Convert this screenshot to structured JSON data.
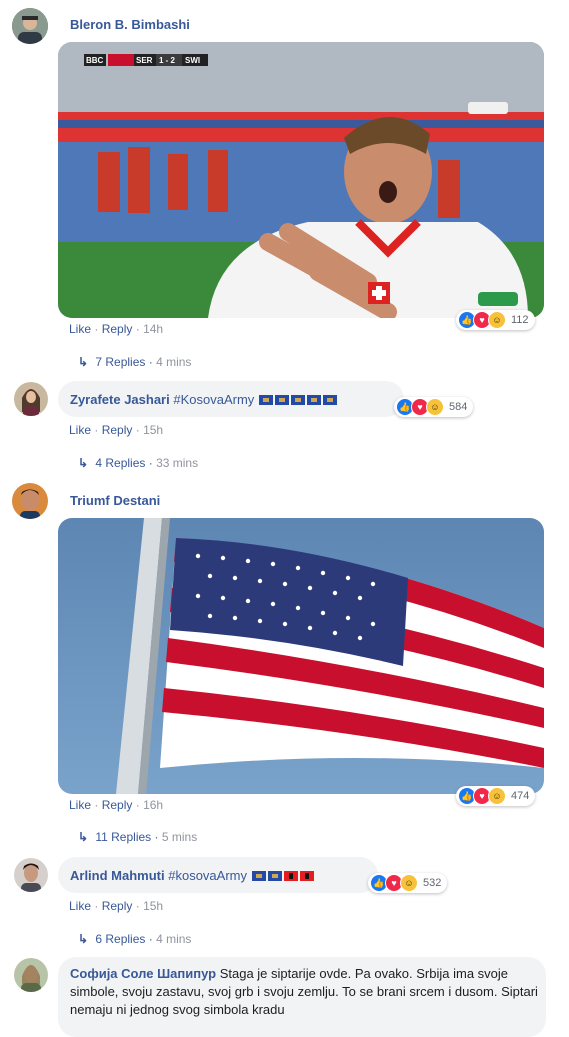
{
  "comments": [
    {
      "author": "Bleron B. Bimbashi",
      "actions": {
        "like": "Like",
        "reply": "Reply",
        "time": "14h"
      },
      "media": {
        "scoreboard": {
          "left_team": "SER",
          "score": "1 - 2",
          "right_team": "SWI",
          "broadcaster": "BBC"
        }
      },
      "reactions": {
        "count": "112"
      },
      "replies": {
        "label": "7 Replies",
        "ago": "4 mins"
      }
    },
    {
      "author": "Zyrafete Jashari",
      "text": "#KosovaArmy",
      "actions": {
        "like": "Like",
        "reply": "Reply",
        "time": "15h"
      },
      "reactions": {
        "count": "584"
      },
      "replies": {
        "label": "4 Replies",
        "ago": "33 mins"
      }
    },
    {
      "author": "Triumf Destani",
      "actions": {
        "like": "Like",
        "reply": "Reply",
        "time": "16h"
      },
      "reactions": {
        "count": "474"
      },
      "replies": {
        "label": "11 Replies",
        "ago": "5 mins"
      }
    },
    {
      "author": "Arlind Mahmuti",
      "text": "#kosovaArmy",
      "actions": {
        "like": "Like",
        "reply": "Reply",
        "time": "15h"
      },
      "reactions": {
        "count": "532"
      },
      "replies": {
        "label": "6 Replies",
        "ago": "4 mins"
      }
    },
    {
      "author": "Софија Соле Шапипур",
      "text": "Staga je siptarije ovde. Pa ovako. Srbija ima svoje simbole, svoju zastavu, svoj grb i svoju zemlju. To se brani srcem i dusom. Siptari nemaju ni jednog svog simbola kradu"
    }
  ],
  "separator": "·",
  "colors": {
    "link": "#385898",
    "meta": "#90949c",
    "bubble": "#f2f3f5",
    "like": "#1877f2",
    "love": "#f0284a",
    "haha": "#f7c23a"
  },
  "icons": {
    "reply_arrow": "reply-arrow-icon",
    "like": "like-reaction-icon",
    "love": "love-reaction-icon",
    "haha": "haha-reaction-icon"
  }
}
